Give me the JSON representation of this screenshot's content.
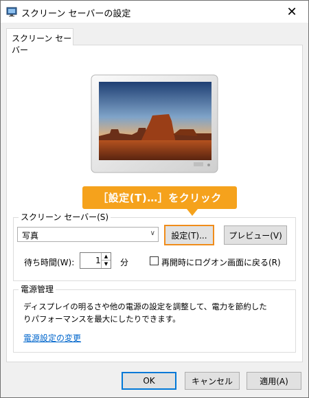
{
  "window": {
    "title": "スクリーン セーバーの設定",
    "close": "✕"
  },
  "tab": {
    "label": "スクリーン セーバー"
  },
  "callout": {
    "text": "［設定(T)…］をクリック"
  },
  "screensaver": {
    "group_label": "スクリーン セーバー(S)",
    "selected": "写真",
    "settings_button": "設定(T)...",
    "preview_button": "プレビュー(V)",
    "wait_label": "待ち時間(W):",
    "wait_value": "1",
    "wait_unit": "分",
    "resume_checkbox_label": "再開時にログオン画面に戻る(R)",
    "resume_checked": false
  },
  "power": {
    "group_label": "電源管理",
    "description_line1": "ディスプレイの明るさや他の電源の設定を調整して、電力を節約した",
    "description_line2": "りパフォーマンスを最大にしたりできます。",
    "link": "電源設定の変更"
  },
  "footer": {
    "ok": "OK",
    "cancel": "キャンセル",
    "apply": "適用(A)"
  },
  "colors": {
    "accent_highlight": "#f08c1a",
    "callout": "#f5a21c",
    "link": "#0066cc",
    "primary_border": "#0078d7"
  }
}
